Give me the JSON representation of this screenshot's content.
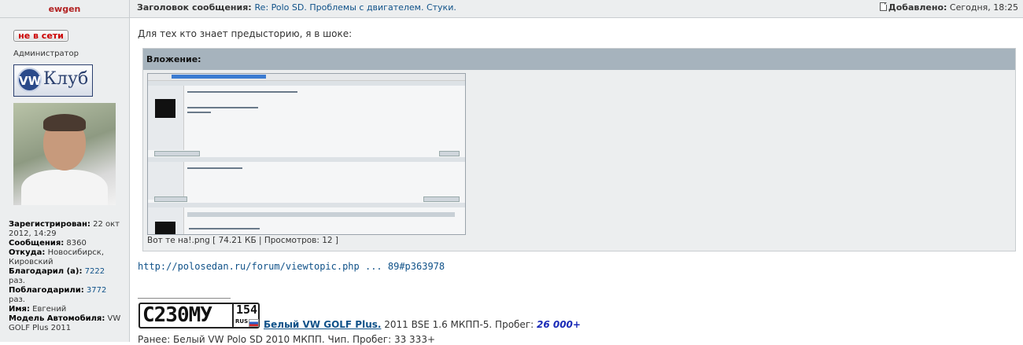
{
  "post": {
    "author": "ewgen",
    "subject_label": "Заголовок сообщения:",
    "subject": "Re: Polo SD. Проблемы с двигателем. Стуки.",
    "added_label": "Добавлено:",
    "added_time": "Сегодня, 18:25",
    "body_line1": "Для тех кто знает предысторию, я в шоке:",
    "attachment_label": "Вложение:",
    "attachment_caption": "Вот те на!.png [ 74.21 КБ | Просмотров: 12 ]",
    "link": "http://polosedan.ru/forum/viewtopic.php ... 89#p363978"
  },
  "user": {
    "status": "не в сети",
    "rank": "Администратор",
    "club_badge": "Клуб",
    "registered_label": "Зарегистрирован:",
    "registered": "22 окт 2012, 14:29",
    "messages_label": "Сообщения:",
    "messages": "8360",
    "from_label": "Откуда:",
    "from": "Новосибирск, Кировский",
    "thanked_label": "Благодарил (а):",
    "thanked": "7222",
    "thanked_suffix": "раз.",
    "thanked_by_label": "Поблагодарили:",
    "thanked_by": "3772",
    "thanked_by_suffix": "раз.",
    "name_label": "Имя:",
    "name": "Евгений",
    "car_label": "Модель Автомобиля:",
    "car": "VW GOLF Plus 2011"
  },
  "signature": {
    "plate_number": "С230МУ",
    "plate_region": "154",
    "plate_country": "RUS",
    "car_link": "Белый VW GOLF Plus.",
    "car_details": " 2011 BSE 1.6 МКПП-5. Пробег: ",
    "mileage": "26 000+",
    "previous": "Ранее: Белый VW Polo SD 2010 МКПП. Чип. Пробег: 33 333+"
  },
  "colors": {
    "header_bg": "#eceeef",
    "attachment_header": "#a6b3bd",
    "link": "#105289",
    "author": "#b22222"
  }
}
